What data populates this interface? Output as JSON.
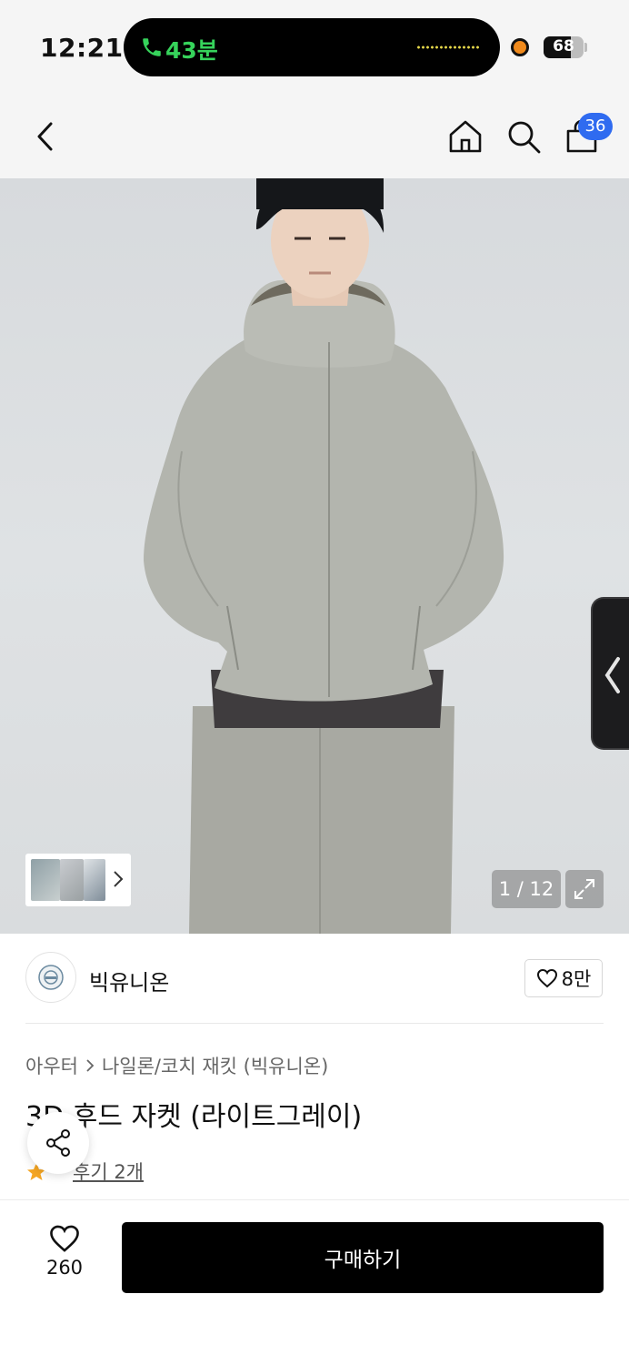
{
  "status_bar": {
    "time": "12:21",
    "call_duration": "43분",
    "battery_level": "68",
    "battery_percent": 68
  },
  "header": {
    "cart_count": "36",
    "icons": [
      "back-icon",
      "home-icon",
      "search-icon",
      "cart-icon"
    ]
  },
  "gallery": {
    "counter": "1 / 12"
  },
  "brand": {
    "name": "빅유니온",
    "like_count": "8만"
  },
  "product": {
    "breadcrumb_category": "아우터",
    "breadcrumb_subcategory": "나일론/코치 재킷 (빅유니온)",
    "title": "3D 후드 자켓 (라이트그레이)",
    "review_link": "후기 2개"
  },
  "bottom_bar": {
    "wish_count": "260",
    "buy_label": "구매하기"
  },
  "colors": {
    "call_green": "#36d35b",
    "badge_blue": "#2f6bf0",
    "star_orange": "#f5a623",
    "buy_black": "#000000"
  }
}
